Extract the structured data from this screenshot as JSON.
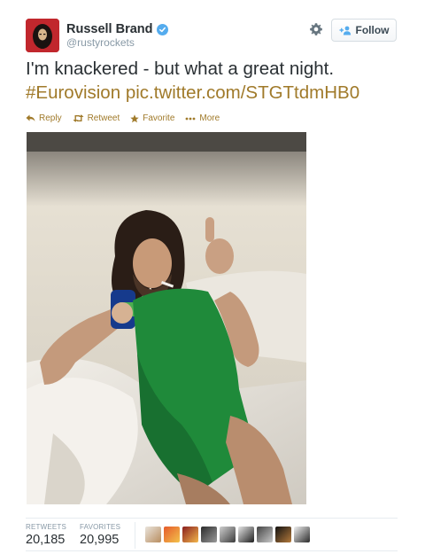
{
  "header": {
    "display_name": "Russell Brand",
    "handle": "@rustyrockets",
    "verified_icon": "verified-badge-icon",
    "settings_icon": "gear-icon",
    "follow_label": "Follow"
  },
  "tweet": {
    "text": "I'm knackered - but what a great night.",
    "hashtag": "#Eurovision",
    "media_link": "pic.twitter.com/STGTtdmHB0"
  },
  "actions": [
    {
      "label": "Reply",
      "icon": "reply-icon"
    },
    {
      "label": "Retweet",
      "icon": "retweet-icon"
    },
    {
      "label": "Favorite",
      "icon": "star-icon"
    },
    {
      "label": "More",
      "icon": "more-dots-icon"
    }
  ],
  "stats": {
    "retweets_label": "RETWEETS",
    "retweets_value": "20,185",
    "favorites_label": "FAVORITES",
    "favorites_value": "20,995"
  },
  "colors": {
    "link": "#a07a2a",
    "verified": "#55acee",
    "dress": "#1f8a3a"
  }
}
